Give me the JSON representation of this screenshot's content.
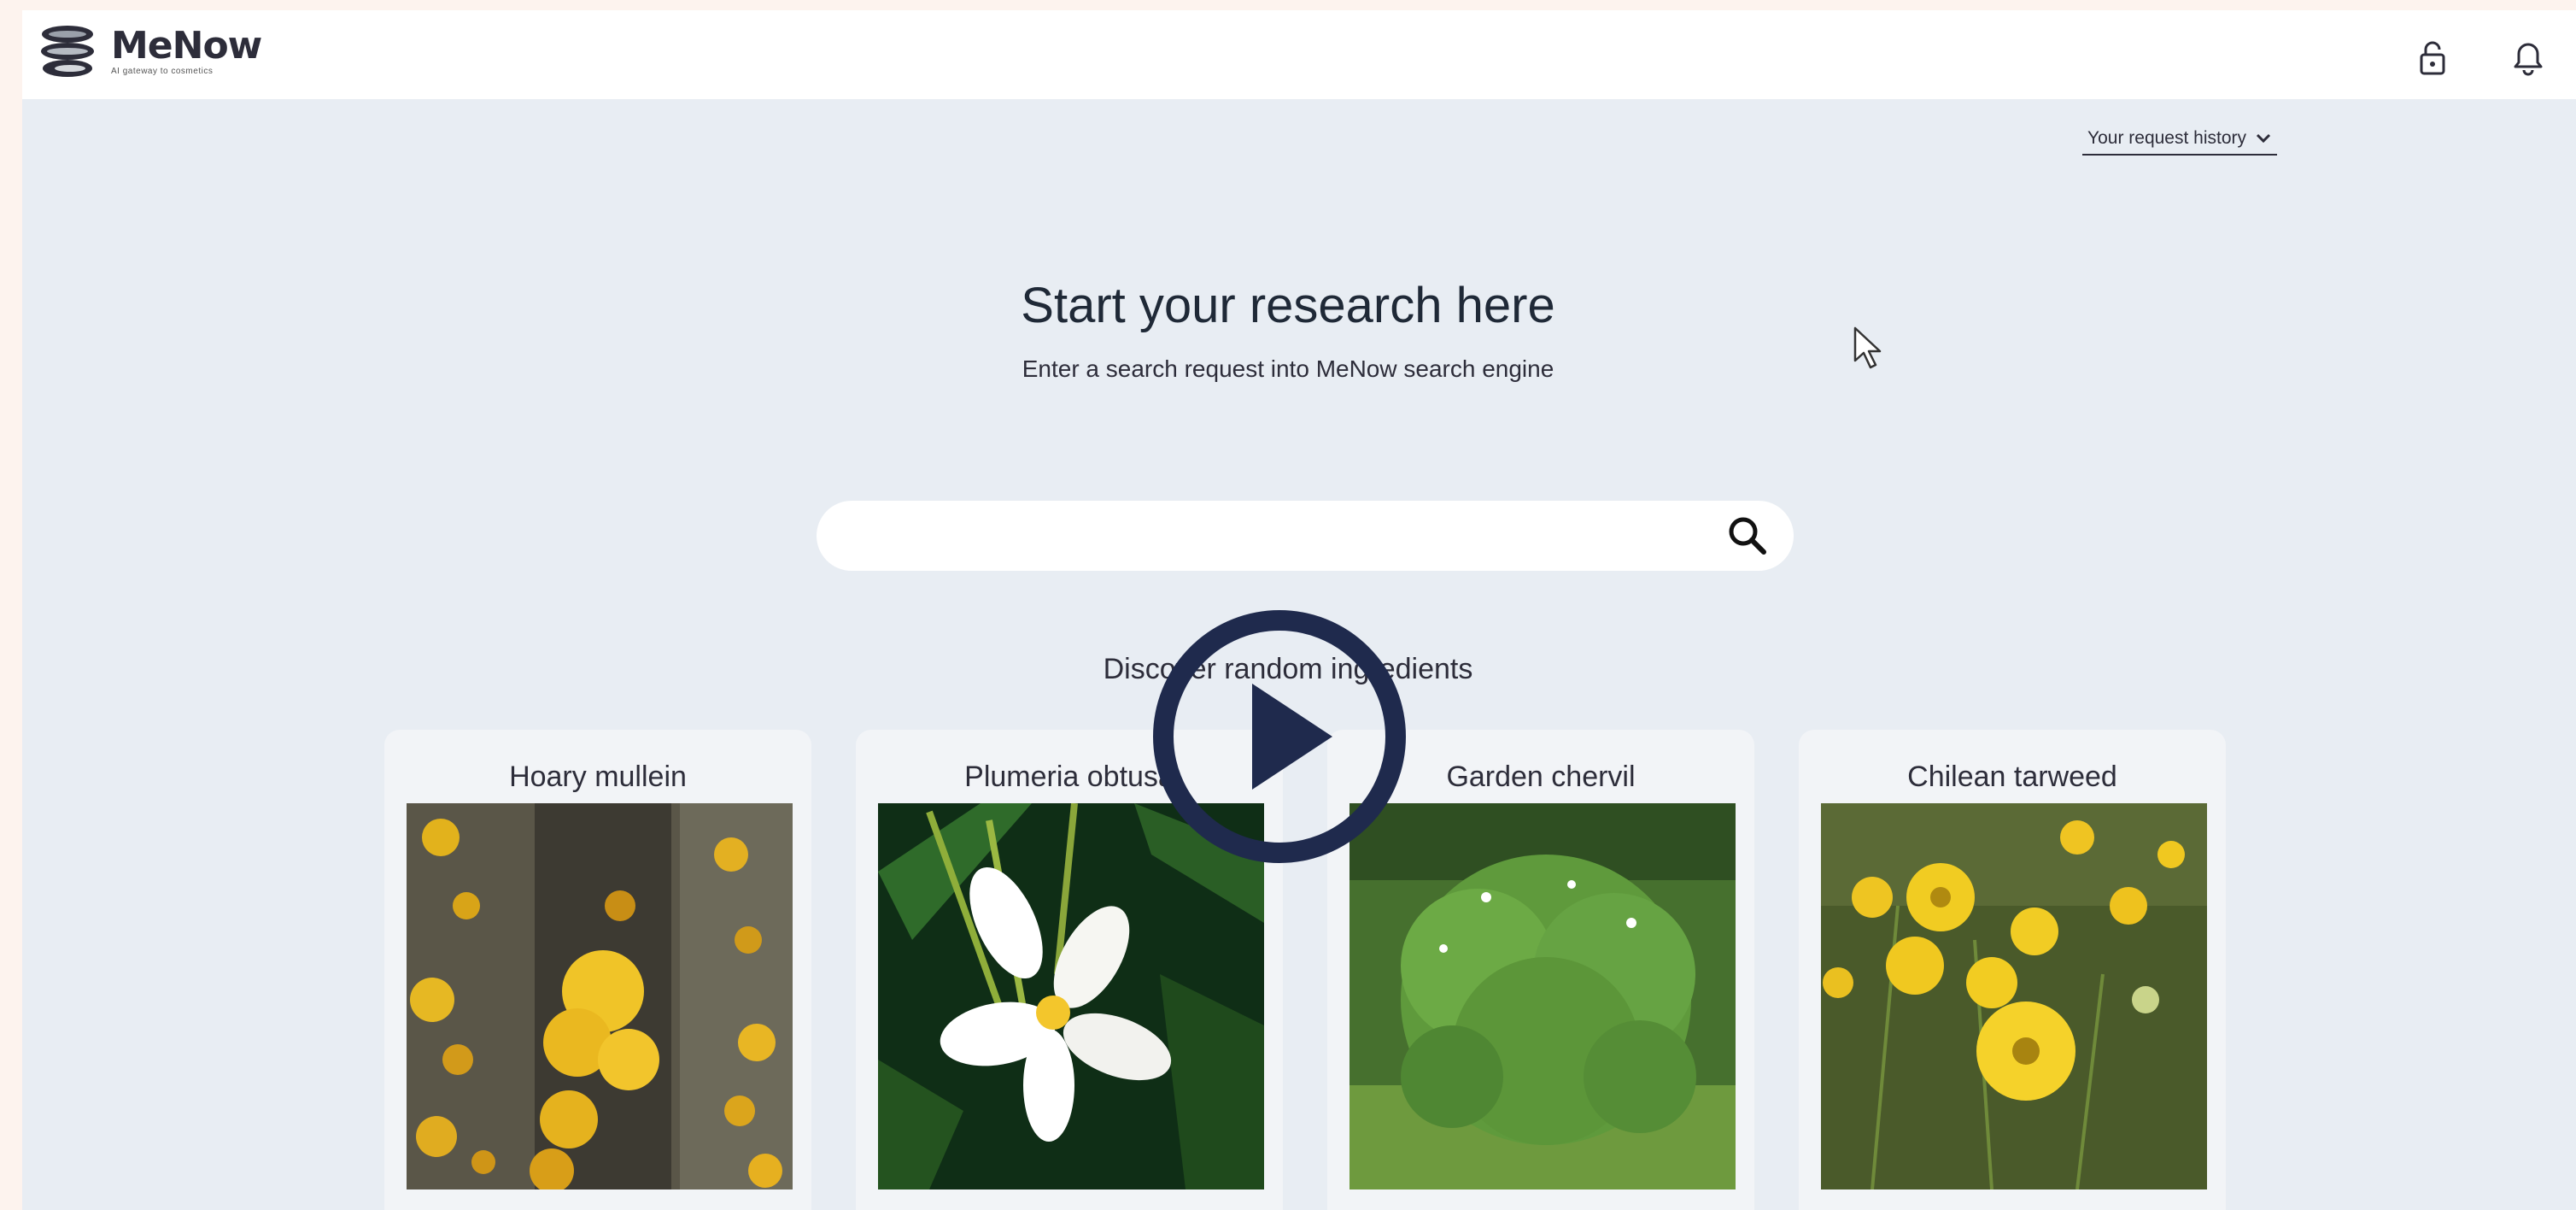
{
  "brand": {
    "name": "MeNow",
    "tagline": "AI gateway to cosmetics"
  },
  "header": {
    "icons": [
      "lock-icon",
      "bell-icon"
    ]
  },
  "history": {
    "label": "Your request history"
  },
  "hero": {
    "title": "Start your research here",
    "subtitle": "Enter a search request into MeNow search engine"
  },
  "search": {
    "value": "",
    "placeholder": ""
  },
  "discover": {
    "heading": "Discover random ingredients",
    "cards": [
      {
        "name": "Hoary mullein"
      },
      {
        "name": "Plumeria obtusa"
      },
      {
        "name": "Garden chervil"
      },
      {
        "name": "Chilean tarweed"
      }
    ]
  },
  "colors": {
    "background": "#e8edf3",
    "header": "#ffffff",
    "play_button": "#1f2a4d",
    "page_border": "#fdf3ee"
  }
}
